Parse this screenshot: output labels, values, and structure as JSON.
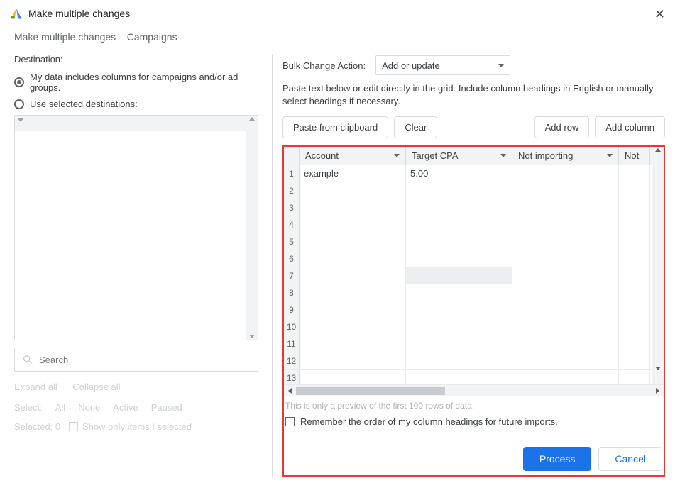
{
  "header": {
    "title": "Make multiple changes"
  },
  "subtitle": "Make multiple changes – Campaigns",
  "left": {
    "destination_label": "Destination:",
    "radio1": "My data includes columns for campaigns and/or ad groups.",
    "radio2": "Use selected destinations:",
    "search_placeholder": "Search",
    "expand": "Expand all",
    "collapse": "Collapse all",
    "select_label": "Select:",
    "sel_all": "All",
    "sel_none": "None",
    "sel_active": "Active",
    "sel_paused": "Paused",
    "selected_text": "Selected: 0",
    "show_only": "Show only items I selected"
  },
  "right": {
    "bca_label": "Bulk Change Action:",
    "bca_value": "Add or update",
    "hint": "Paste text below or edit directly in the grid. Include column headings in English or manually select headings if necessary.",
    "paste": "Paste from clipboard",
    "clear": "Clear",
    "add_row": "Add row",
    "add_col": "Add column",
    "columns": [
      "Account",
      "Target CPA",
      "Not importing",
      "Not"
    ],
    "rows": [
      {
        "n": "1",
        "c": [
          "example",
          "5.00",
          "",
          ""
        ]
      },
      {
        "n": "2",
        "c": [
          "",
          "",
          "",
          ""
        ]
      },
      {
        "n": "3",
        "c": [
          "",
          "",
          "",
          ""
        ]
      },
      {
        "n": "4",
        "c": [
          "",
          "",
          "",
          ""
        ]
      },
      {
        "n": "5",
        "c": [
          "",
          "",
          "",
          ""
        ]
      },
      {
        "n": "6",
        "c": [
          "",
          "",
          "",
          ""
        ]
      },
      {
        "n": "7",
        "c": [
          "",
          "",
          "",
          ""
        ]
      },
      {
        "n": "8",
        "c": [
          "",
          "",
          "",
          ""
        ]
      },
      {
        "n": "9",
        "c": [
          "",
          "",
          "",
          ""
        ]
      },
      {
        "n": "10",
        "c": [
          "",
          "",
          "",
          ""
        ]
      },
      {
        "n": "11",
        "c": [
          "",
          "",
          "",
          ""
        ]
      },
      {
        "n": "12",
        "c": [
          "",
          "",
          "",
          ""
        ]
      },
      {
        "n": "13",
        "c": [
          "",
          "",
          "",
          ""
        ]
      }
    ],
    "preview_note": "This is only a preview of the first 100 rows of data.",
    "remember": "Remember the order of my column headings for future imports.",
    "process": "Process",
    "cancel": "Cancel"
  }
}
